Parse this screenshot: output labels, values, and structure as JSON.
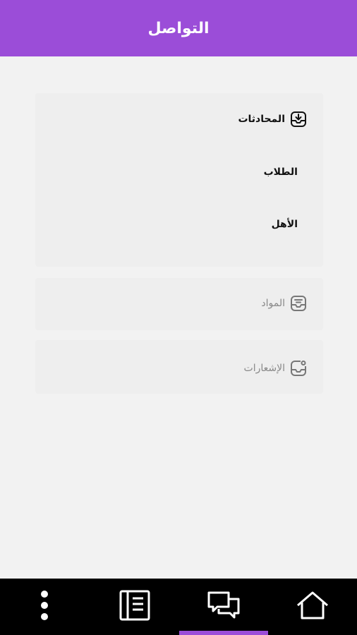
{
  "header": {
    "title": "التواصل"
  },
  "sections": [
    {
      "label": "المحادثات",
      "icon": "inbox-download-icon",
      "state": "expanded",
      "items": [
        {
          "label": "الطلاب"
        },
        {
          "label": "الأهل"
        }
      ]
    },
    {
      "label": "المواد",
      "icon": "inbox-lines-icon",
      "state": "collapsed"
    },
    {
      "label": "الإشعارات",
      "icon": "inbox-notification-icon",
      "state": "collapsed"
    }
  ],
  "bottom_nav": {
    "items": [
      "more-icon",
      "notebook-icon",
      "chat-icon",
      "home-icon"
    ],
    "selected": "chat-icon"
  },
  "colors": {
    "accent": "#9b4dd8",
    "background": "#f2f2f2",
    "card": "#eeeeee",
    "nav_background": "#000000"
  }
}
